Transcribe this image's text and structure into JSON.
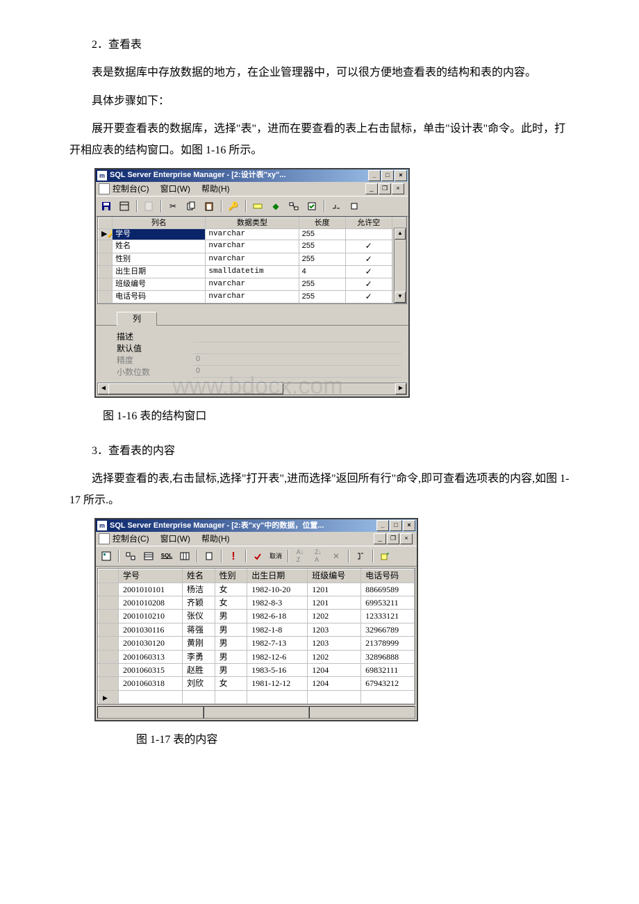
{
  "paragraphs": {
    "h2": "2．查看表",
    "p1": "表是数据库中存放数据的地方，在企业管理器中，可以很方便地查看表的结构和表的内容。",
    "p2": "具体步骤如下：",
    "p3": "展开要查看表的数据库，选择\"表\"，进而在要查看的表上右击鼠标，单击\"设计表\"命令。此时，打开相应表的结构窗口。如图 1-16 所示。",
    "cap1": "图 1-16 表的结构窗口",
    "h3": "3．查看表的内容",
    "p4": "选择要查看的表,右击鼠标,选择\"打开表\",进而选择\"返回所有行\"命令,即可查看选项表的内容,如图 1-17 所示.。",
    "cap2": "图 1-17 表的内容"
  },
  "win1": {
    "title": "SQL Server Enterprise Manager - [2:设计表\"xy\"...",
    "menus": {
      "console": "控制台(C)",
      "window": "窗口(W)",
      "help": "帮助(H)"
    },
    "grid": {
      "headers": {
        "name": "列名",
        "dtype": "数据类型",
        "len": "长度",
        "null": "允许空"
      },
      "rows": [
        {
          "name": "学号",
          "dtype": "nvarchar",
          "len": "255",
          "null": false,
          "sel": true,
          "key": true
        },
        {
          "name": "姓名",
          "dtype": "nvarchar",
          "len": "255",
          "null": true
        },
        {
          "name": "性别",
          "dtype": "nvarchar",
          "len": "255",
          "null": true
        },
        {
          "name": "出生日期",
          "dtype": "smalldatetim",
          "len": "4",
          "null": true
        },
        {
          "name": "班级编号",
          "dtype": "nvarchar",
          "len": "255",
          "null": true
        },
        {
          "name": "电话号码",
          "dtype": "nvarchar",
          "len": "255",
          "null": true
        }
      ]
    },
    "tab": "列",
    "props": {
      "desc": {
        "label": "描述",
        "value": ""
      },
      "def": {
        "label": "默认值",
        "value": ""
      },
      "prec": {
        "label": "精度",
        "value": "0"
      },
      "scale": {
        "label": "小数位数",
        "value": "0"
      }
    }
  },
  "win2": {
    "title": "SQL Server Enterprise Manager - [2:表\"xy\"中的数据，位置...",
    "menus": {
      "console": "控制台(C)",
      "window": "窗口(W)",
      "help": "帮助(H)"
    },
    "headers": {
      "sid": "学号",
      "name": "姓名",
      "sex": "性别",
      "dob": "出生日期",
      "cls": "班级编号",
      "tel": "电话号码"
    },
    "rows": [
      {
        "sid": "2001010101",
        "name": "杨洁",
        "sex": "女",
        "dob": "1982-10-20",
        "cls": "1201",
        "tel": "88669589"
      },
      {
        "sid": "2001010208",
        "name": "齐颖",
        "sex": "女",
        "dob": "1982-8-3",
        "cls": "1201",
        "tel": "69953211"
      },
      {
        "sid": "2001010210",
        "name": "张仪",
        "sex": "男",
        "dob": "1982-6-18",
        "cls": "1202",
        "tel": "12333121"
      },
      {
        "sid": "2001030116",
        "name": "蒋强",
        "sex": "男",
        "dob": "1982-1-8",
        "cls": "1203",
        "tel": "32966789"
      },
      {
        "sid": "2001030120",
        "name": "黄刚",
        "sex": "男",
        "dob": "1982-7-13",
        "cls": "1203",
        "tel": "21378999"
      },
      {
        "sid": "2001060313",
        "name": "李勇",
        "sex": "男",
        "dob": "1982-12-6",
        "cls": "1202",
        "tel": "32896888"
      },
      {
        "sid": "2001060315",
        "name": "赵胜",
        "sex": "男",
        "dob": "1983-5-16",
        "cls": "1204",
        "tel": "69832111"
      },
      {
        "sid": "2001060318",
        "name": "刘欣",
        "sex": "女",
        "dob": "1981-12-12",
        "cls": "1204",
        "tel": "67943212"
      }
    ]
  },
  "watermark": "www.bdocx.com"
}
